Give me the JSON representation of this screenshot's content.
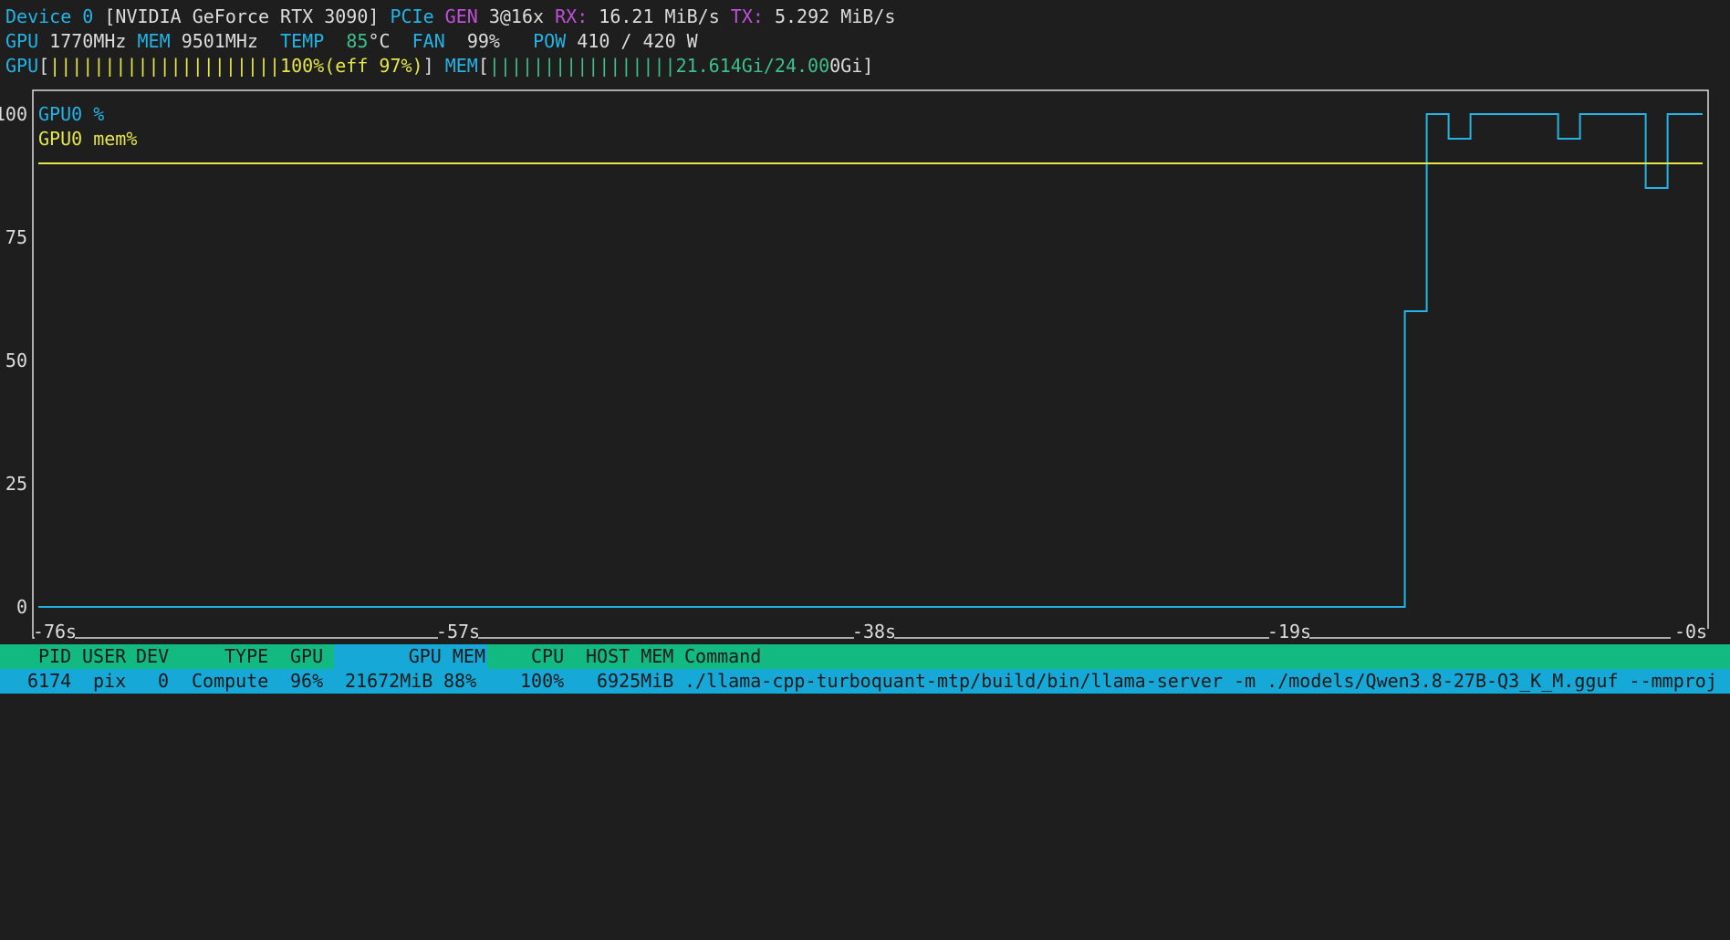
{
  "header": {
    "device_label": "Device 0",
    "device_name": "[NVIDIA GeForce RTX 3090]",
    "pcie_label": "PCIe",
    "gen_label": "GEN",
    "gen_value": "3@16x",
    "rx_label": "RX:",
    "rx_value": "16.21 MiB/s",
    "tx_label": "TX:",
    "tx_value": "5.292 MiB/s",
    "gpu_clock_label": "GPU",
    "gpu_clock_value": "1770MHz",
    "mem_clock_label": "MEM",
    "mem_clock_value": "9501MHz",
    "temp_label": "TEMP",
    "temp_value": "85",
    "temp_unit": "°C",
    "fan_label": "FAN",
    "fan_value": "99%",
    "pow_label": "POW",
    "pow_value": "410 / 420 W",
    "gpu_bar_label": "GPU",
    "gpu_bar_open": "[",
    "gpu_bar_bars": "|||||||||||||||||||||",
    "gpu_bar_text": "100%(eff 97%)",
    "gpu_bar_close": "]",
    "gpu_util_fraction": 1.0,
    "mem_bar_label": "MEM",
    "mem_bar_open": "[",
    "mem_bar_bars": "|||||||||||||||||",
    "mem_bar_text_green": "21.614Gi/24.00",
    "mem_bar_text_white": "0Gi",
    "mem_bar_close": "]"
  },
  "chart_data": {
    "type": "line",
    "legend": [
      {
        "name": "GPU0 %",
        "color": "#22b4e6"
      },
      {
        "name": "GPU0 mem%",
        "color": "#e6e64a"
      }
    ],
    "y_ticks": [
      "100",
      "75",
      "50",
      "25",
      "0"
    ],
    "x_ticks": [
      "-76s",
      "-57s",
      "-38s",
      "-19s",
      "-0s"
    ],
    "ylim": [
      0,
      100
    ],
    "xlim": [
      -76,
      0
    ],
    "series": [
      {
        "name": "GPU0 %",
        "color": "#22b4e6",
        "x": [
          -76,
          -13.6,
          -12.6,
          -11.6,
          -10.6,
          -9.6,
          -6.6,
          -5.6,
          -2.6,
          -1.6,
          -0.6
        ],
        "y": [
          0,
          60,
          100,
          95,
          100,
          100,
          95,
          100,
          85,
          100,
          100
        ]
      },
      {
        "name": "GPU0 mem%",
        "color": "#e6e64a",
        "x": [
          -76,
          0
        ],
        "y": [
          90,
          90
        ]
      }
    ]
  },
  "process_table": {
    "headers": {
      "pid": "PID",
      "user": "USER",
      "dev": "DEV",
      "type": "TYPE",
      "gpu": "GPU",
      "gpu_mem": "GPU MEM",
      "cpu": "CPU",
      "host_mem": "HOST MEM",
      "command": "Command"
    },
    "rows": [
      {
        "pid": "6174",
        "user": "pix",
        "dev": "0",
        "type": "Compute",
        "gpu": "96%",
        "gpu_mem": "21672MiB",
        "gpu_mem_pct": "88%",
        "cpu": "100%",
        "host_mem": "6925MiB",
        "command": "./llama-cpp-turboquant-mtp/build/bin/llama-server -m ./models/Qwen3.8-27B-Q3_K_M.gguf --mmproj"
      }
    ]
  }
}
